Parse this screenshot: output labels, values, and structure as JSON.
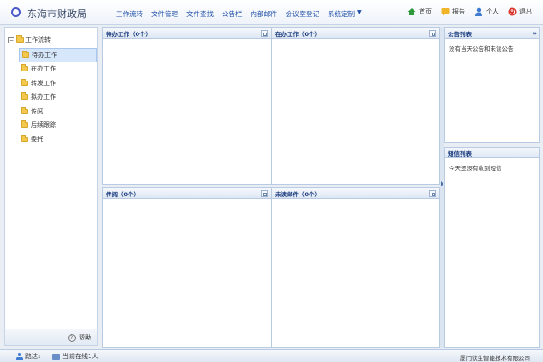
{
  "app": {
    "title": "东海市财政局"
  },
  "nav": {
    "items": [
      "工作流转",
      "文件管理",
      "文件查找",
      "公告栏",
      "内部邮件",
      "会议室登记",
      "系统定制"
    ]
  },
  "top_actions": {
    "home": "首页",
    "report": "报告",
    "personal": "个人",
    "logout": "退出"
  },
  "sidebar": {
    "root": "工作流转",
    "items": [
      "待办工作",
      "在办工作",
      "转发工作",
      "拟办工作",
      "传阅",
      "后续跟踪",
      "委托"
    ],
    "help": "帮助"
  },
  "panels": {
    "pending": {
      "title": "待办工作（0个）"
    },
    "inprogress": {
      "title": "在办工作（0个）"
    },
    "circulate": {
      "title": "传阅（0个）"
    },
    "unread": {
      "title": "未读邮件（0个）"
    },
    "announce": {
      "title": "公告列表",
      "empty": "没有当天公告和未读公告",
      "collapse": "»"
    },
    "sms": {
      "title": "短信列表",
      "empty": "今天还没有收到短信"
    }
  },
  "status": {
    "user_label": "路达:",
    "online": "当前在线1人",
    "company": "厦门欣生智能技术有限公司"
  },
  "colors": {
    "accent": "#1f4fa8",
    "panel_title": "#15367a",
    "border": "#b9cbe3"
  }
}
